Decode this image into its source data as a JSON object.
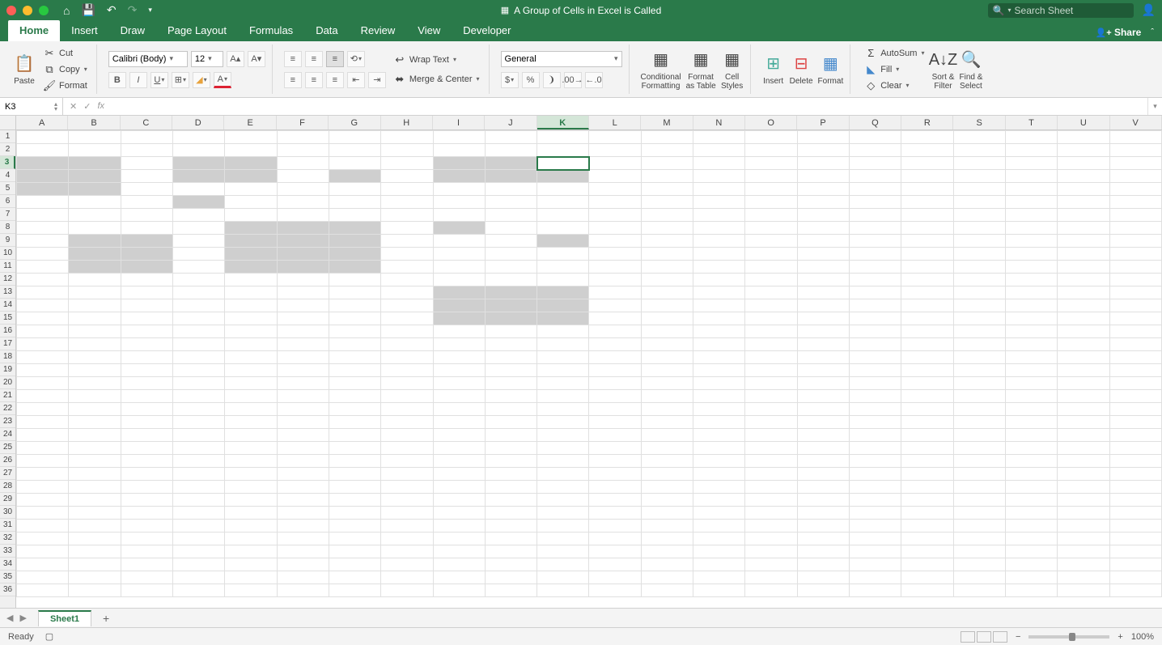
{
  "titlebar": {
    "document_title": "A Group of Cells in Excel is Called",
    "search_placeholder": "Search Sheet"
  },
  "tabs": {
    "items": [
      "Home",
      "Insert",
      "Draw",
      "Page Layout",
      "Formulas",
      "Data",
      "Review",
      "View",
      "Developer"
    ],
    "active": "Home",
    "share_label": "Share"
  },
  "ribbon": {
    "paste_label": "Paste",
    "cut_label": "Cut",
    "copy_label": "Copy",
    "format_painter_label": "Format",
    "font_name": "Calibri (Body)",
    "font_size": "12",
    "wrap_text_label": "Wrap Text",
    "merge_center_label": "Merge & Center",
    "number_format": "General",
    "cond_fmt_label": "Conditional\nFormatting",
    "fmt_table_label": "Format\nas Table",
    "cell_styles_label": "Cell\nStyles",
    "insert_label": "Insert",
    "delete_label": "Delete",
    "format_label": "Format",
    "autosum_label": "AutoSum",
    "fill_label": "Fill",
    "clear_label": "Clear",
    "sort_filter_label": "Sort &\nFilter",
    "find_select_label": "Find &\nSelect"
  },
  "formula_bar": {
    "name_box": "K3",
    "formula": ""
  },
  "grid": {
    "columns": [
      "A",
      "B",
      "C",
      "D",
      "E",
      "F",
      "G",
      "H",
      "I",
      "J",
      "K",
      "L",
      "M",
      "N",
      "O",
      "P",
      "Q",
      "R",
      "S",
      "T",
      "U",
      "V"
    ],
    "row_count": 36,
    "active_cell": {
      "row": 3,
      "col": 11
    },
    "selected_cells": [
      {
        "r": 3,
        "c": 1
      },
      {
        "r": 3,
        "c": 2
      },
      {
        "r": 4,
        "c": 1
      },
      {
        "r": 4,
        "c": 2
      },
      {
        "r": 5,
        "c": 1
      },
      {
        "r": 5,
        "c": 2
      },
      {
        "r": 3,
        "c": 4
      },
      {
        "r": 3,
        "c": 5
      },
      {
        "r": 4,
        "c": 4
      },
      {
        "r": 4,
        "c": 5
      },
      {
        "r": 6,
        "c": 4
      },
      {
        "r": 4,
        "c": 7
      },
      {
        "r": 3,
        "c": 9
      },
      {
        "r": 3,
        "c": 10
      },
      {
        "r": 3,
        "c": 11
      },
      {
        "r": 4,
        "c": 9
      },
      {
        "r": 4,
        "c": 10
      },
      {
        "r": 4,
        "c": 11
      },
      {
        "r": 8,
        "c": 9
      },
      {
        "r": 9,
        "c": 2
      },
      {
        "r": 9,
        "c": 3
      },
      {
        "r": 10,
        "c": 2
      },
      {
        "r": 10,
        "c": 3
      },
      {
        "r": 11,
        "c": 2
      },
      {
        "r": 11,
        "c": 3
      },
      {
        "r": 8,
        "c": 5
      },
      {
        "r": 8,
        "c": 6
      },
      {
        "r": 8,
        "c": 7
      },
      {
        "r": 9,
        "c": 5
      },
      {
        "r": 9,
        "c": 6
      },
      {
        "r": 9,
        "c": 7
      },
      {
        "r": 10,
        "c": 5
      },
      {
        "r": 10,
        "c": 6
      },
      {
        "r": 10,
        "c": 7
      },
      {
        "r": 11,
        "c": 5
      },
      {
        "r": 11,
        "c": 6
      },
      {
        "r": 11,
        "c": 7
      },
      {
        "r": 9,
        "c": 11
      },
      {
        "r": 13,
        "c": 9
      },
      {
        "r": 13,
        "c": 10
      },
      {
        "r": 13,
        "c": 11
      },
      {
        "r": 14,
        "c": 9
      },
      {
        "r": 14,
        "c": 10
      },
      {
        "r": 14,
        "c": 11
      },
      {
        "r": 15,
        "c": 9
      },
      {
        "r": 15,
        "c": 10
      },
      {
        "r": 15,
        "c": 11
      }
    ]
  },
  "sheets": {
    "active": "Sheet1"
  },
  "status": {
    "ready": "Ready",
    "zoom": "100%"
  }
}
